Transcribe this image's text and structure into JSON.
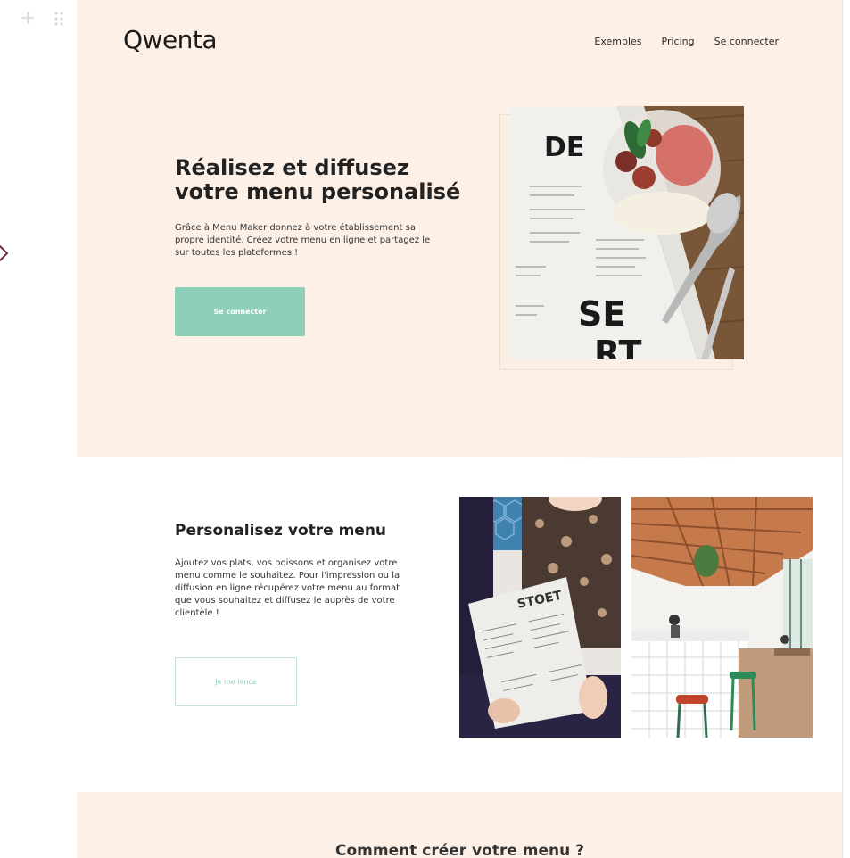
{
  "header": {
    "logo": "Qwenta",
    "nav": [
      "Exemples",
      "Pricing",
      "Se connecter"
    ]
  },
  "hero": {
    "title": "Réalisez et diffusez votre menu personalisé",
    "text": "Grâce à Menu Maker donnez à votre établissement sa propre identité. Créez votre menu en ligne et partagez le sur toutes les plateformes !",
    "button": "Se connecter",
    "image_words": [
      "DE",
      "SE",
      "RT"
    ]
  },
  "customize": {
    "title": "Personalisez votre menu",
    "text": "Ajoutez vos plats, vos boissons et organisez votre menu comme le souhaitez. Pour l'impression ou la diffusion en ligne récupérez votre menu au format que vous souhaitez et diffusez le auprès de votre clientèle !",
    "button": "Je me lance",
    "photo_menu_word": "STOET"
  },
  "howto": {
    "title": "Comment créer votre menu ?"
  },
  "colors": {
    "hero_bg": "#fdf1e7",
    "accent": "#8fcfb9"
  }
}
